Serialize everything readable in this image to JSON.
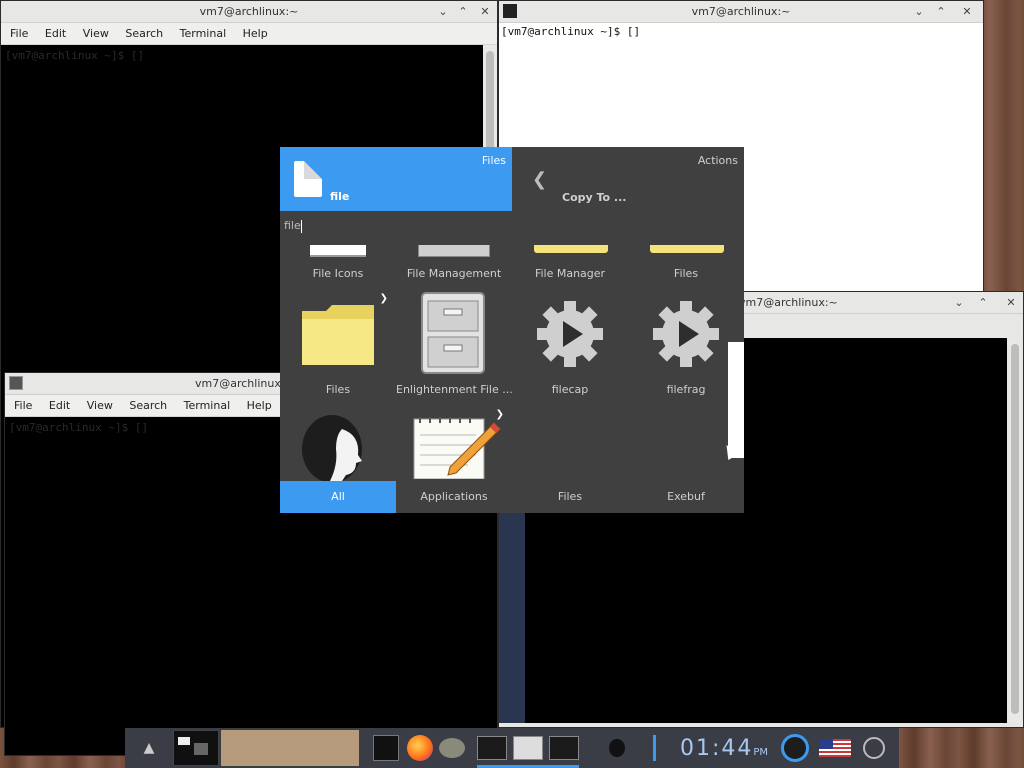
{
  "windows": {
    "top_left": {
      "title": "vm7@archlinux:~",
      "menu": [
        "File",
        "Edit",
        "View",
        "Search",
        "Terminal",
        "Help"
      ],
      "prompt": "[vm7@archlinux ~]$ []"
    },
    "top_right": {
      "title": "vm7@archlinux:~",
      "prompt": "[vm7@archlinux ~]$ []"
    },
    "bottom_left": {
      "title": "vm7@archlinux:~",
      "menu": [
        "File",
        "Edit",
        "View",
        "Search",
        "Terminal",
        "Help"
      ],
      "prompt": "[vm7@archlinux ~]$ []"
    },
    "bottom_right": {
      "title": "vm7@archlinux:~"
    }
  },
  "launcher": {
    "selected_category": "Files",
    "selected_item": "file",
    "actions_label": "Actions",
    "action": "Copy To ...",
    "query": "file",
    "row1": [
      "File Icons",
      "File Management",
      "File Manager",
      "Files"
    ],
    "row2": [
      "Files",
      "Enlightenment File ...",
      "filecap",
      "filefrag"
    ],
    "tabs": [
      "All",
      "Applications",
      "Files",
      "Exebuf"
    ],
    "active_tab": "All"
  },
  "taskbar": {
    "clock": "01:44",
    "ampm": "PM"
  },
  "colors": {
    "accent": "#3c9bf0",
    "launcher_bg": "#404040",
    "taskbar_bg": "#3a3d45",
    "folder": "#f5e27a"
  }
}
